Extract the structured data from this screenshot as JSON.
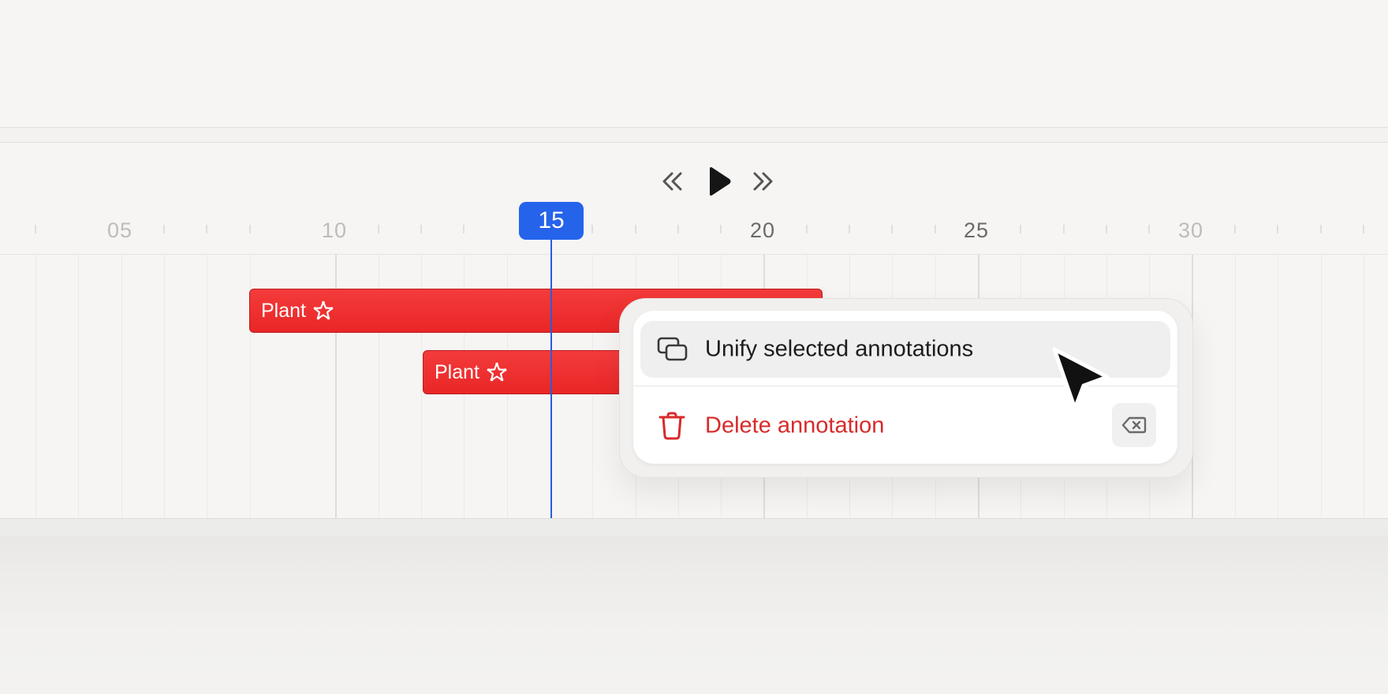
{
  "playback": {
    "rewind_icon": "double-chevron-left-icon",
    "play_icon": "play-icon",
    "forward_icon": "double-chevron-right-icon"
  },
  "ruler": {
    "labels": [
      "05",
      "10",
      "15",
      "20",
      "25",
      "30"
    ]
  },
  "playhead": {
    "value": "15",
    "color": "#2563eb"
  },
  "annotations": [
    {
      "label": "Plant",
      "icon": "starfish-icon",
      "color": "#ee2e2e"
    },
    {
      "label": "Plant",
      "icon": "starfish-icon",
      "color": "#ee2e2e"
    }
  ],
  "context_menu": {
    "unify": {
      "label": "Unify selected annotations",
      "icon": "unify-icon"
    },
    "delete": {
      "label": "Delete annotation",
      "icon": "trash-icon",
      "shortcut_icon": "backspace-icon",
      "color": "#d82a2a"
    }
  }
}
